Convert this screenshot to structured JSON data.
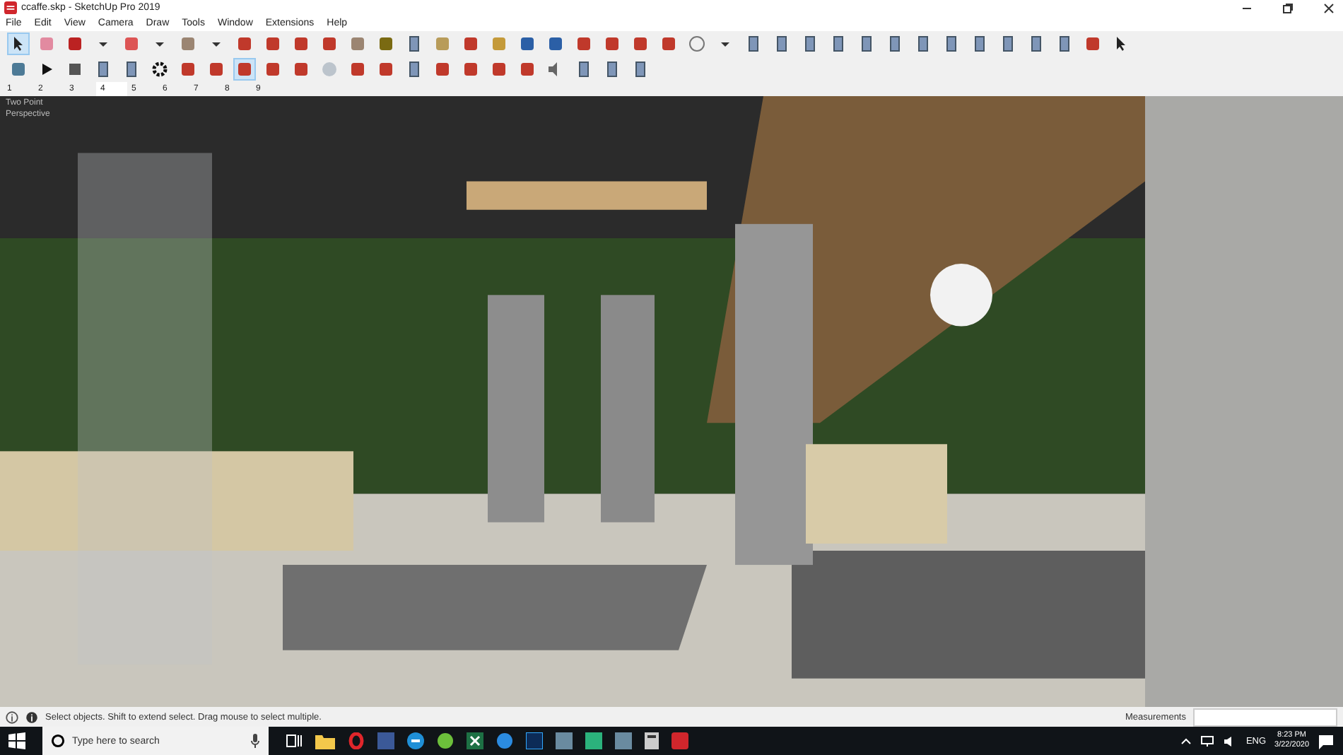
{
  "window": {
    "title": "ccaffe.skp - SketchUp Pro 2019"
  },
  "menu": [
    "File",
    "Edit",
    "View",
    "Camera",
    "Draw",
    "Tools",
    "Window",
    "Extensions",
    "Help"
  ],
  "toolbar_1": [
    {
      "selected": true
    },
    {
      "selected": false
    },
    {
      "selected": false
    },
    {
      "selected": false
    },
    {
      "selected": false
    },
    {
      "selected": false
    },
    {
      "selected": false
    },
    {
      "selected": false
    },
    {
      "selected": false
    },
    {
      "selected": false
    },
    {
      "selected": false
    },
    {
      "selected": false
    },
    {
      "selected": false
    },
    {
      "selected": false
    },
    {
      "selected": false
    },
    {
      "selected": false
    },
    {
      "selected": false
    },
    {
      "selected": false
    },
    {
      "selected": false
    },
    {
      "selected": false
    },
    {
      "selected": false
    },
    {
      "selected": false
    },
    {
      "selected": false
    },
    {
      "selected": false
    },
    {
      "selected": false
    },
    {
      "selected": false
    },
    {
      "selected": false
    },
    {
      "selected": false
    },
    {
      "selected": false
    },
    {
      "selected": false
    },
    {
      "selected": false
    },
    {
      "selected": false
    },
    {
      "selected": false
    },
    {
      "selected": false
    },
    {
      "selected": false
    },
    {
      "selected": false
    },
    {
      "selected": false
    },
    {
      "selected": false
    },
    {
      "selected": false
    },
    {
      "selected": false
    }
  ],
  "toolbar_2": [
    {
      "selected": false
    },
    {
      "selected": false
    },
    {
      "selected": false
    },
    {
      "selected": false
    },
    {
      "selected": false
    },
    {
      "selected": false
    },
    {
      "selected": false
    },
    {
      "selected": false
    },
    {
      "selected": true
    },
    {
      "selected": false
    },
    {
      "selected": false
    },
    {
      "selected": false
    },
    {
      "selected": false
    },
    {
      "selected": false
    },
    {
      "selected": false
    },
    {
      "selected": false
    },
    {
      "selected": false
    },
    {
      "selected": false
    },
    {
      "selected": false
    },
    {
      "selected": false
    },
    {
      "selected": false
    },
    {
      "selected": false
    },
    {
      "selected": false
    }
  ],
  "scene_tabs": [
    {
      "label": "1",
      "selected": false
    },
    {
      "label": "2",
      "selected": false
    },
    {
      "label": "3",
      "selected": false
    },
    {
      "label": "4",
      "selected": true
    },
    {
      "label": "5",
      "selected": false
    },
    {
      "label": "6",
      "selected": false
    },
    {
      "label": "7",
      "selected": false
    },
    {
      "label": "8",
      "selected": false
    },
    {
      "label": "9",
      "selected": false
    }
  ],
  "viewport": {
    "label": "Two Point Perspective"
  },
  "status_bar": {
    "message": "Select objects. Shift to extend select. Drag mouse to select multiple.",
    "measurements_label": "Measurements"
  },
  "taskbar": {
    "search_placeholder": "Type here to search",
    "language": "ENG",
    "time": "8:23 PM",
    "date": "3/22/2020"
  }
}
